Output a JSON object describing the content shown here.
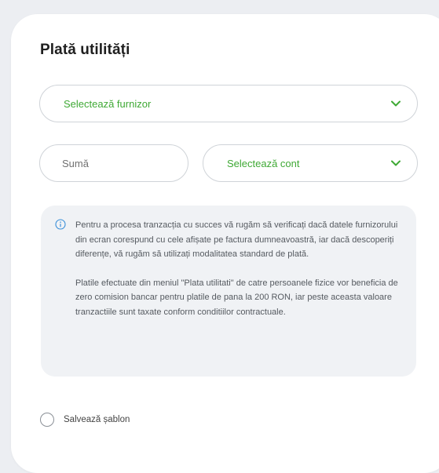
{
  "form": {
    "title": "Plată utilități",
    "supplier": {
      "placeholder": "Selectează furnizor",
      "icon": "chevron-down-icon"
    },
    "amount": {
      "placeholder": "Sumă"
    },
    "account": {
      "placeholder": "Selectează cont",
      "icon": "chevron-down-icon"
    },
    "info": {
      "icon": "info-icon",
      "paragraph1": "Pentru a procesa tranzacția cu succes vă rugăm să verificați dacă datele furnizorului din ecran corespund cu cele afișate pe factura dumneavoastră, iar dacă descoperiți diferențe, vă rugăm să utilizați modalitatea standard de plată.",
      "paragraph2": "Platile efectuate din meniul \"Plata utilitati\" de catre persoanele fizice vor beneficia de zero comision bancar pentru platile de pana la 200 RON, iar peste aceasta valoare tranzactiile sunt taxate conform conditiilor contractuale."
    },
    "save_template": {
      "label": "Salvează șablon",
      "checked": false
    }
  },
  "colors": {
    "accent": "#3fa935",
    "background": "#eceef2",
    "card": "#ffffff",
    "info_background": "#f0f2f5"
  }
}
